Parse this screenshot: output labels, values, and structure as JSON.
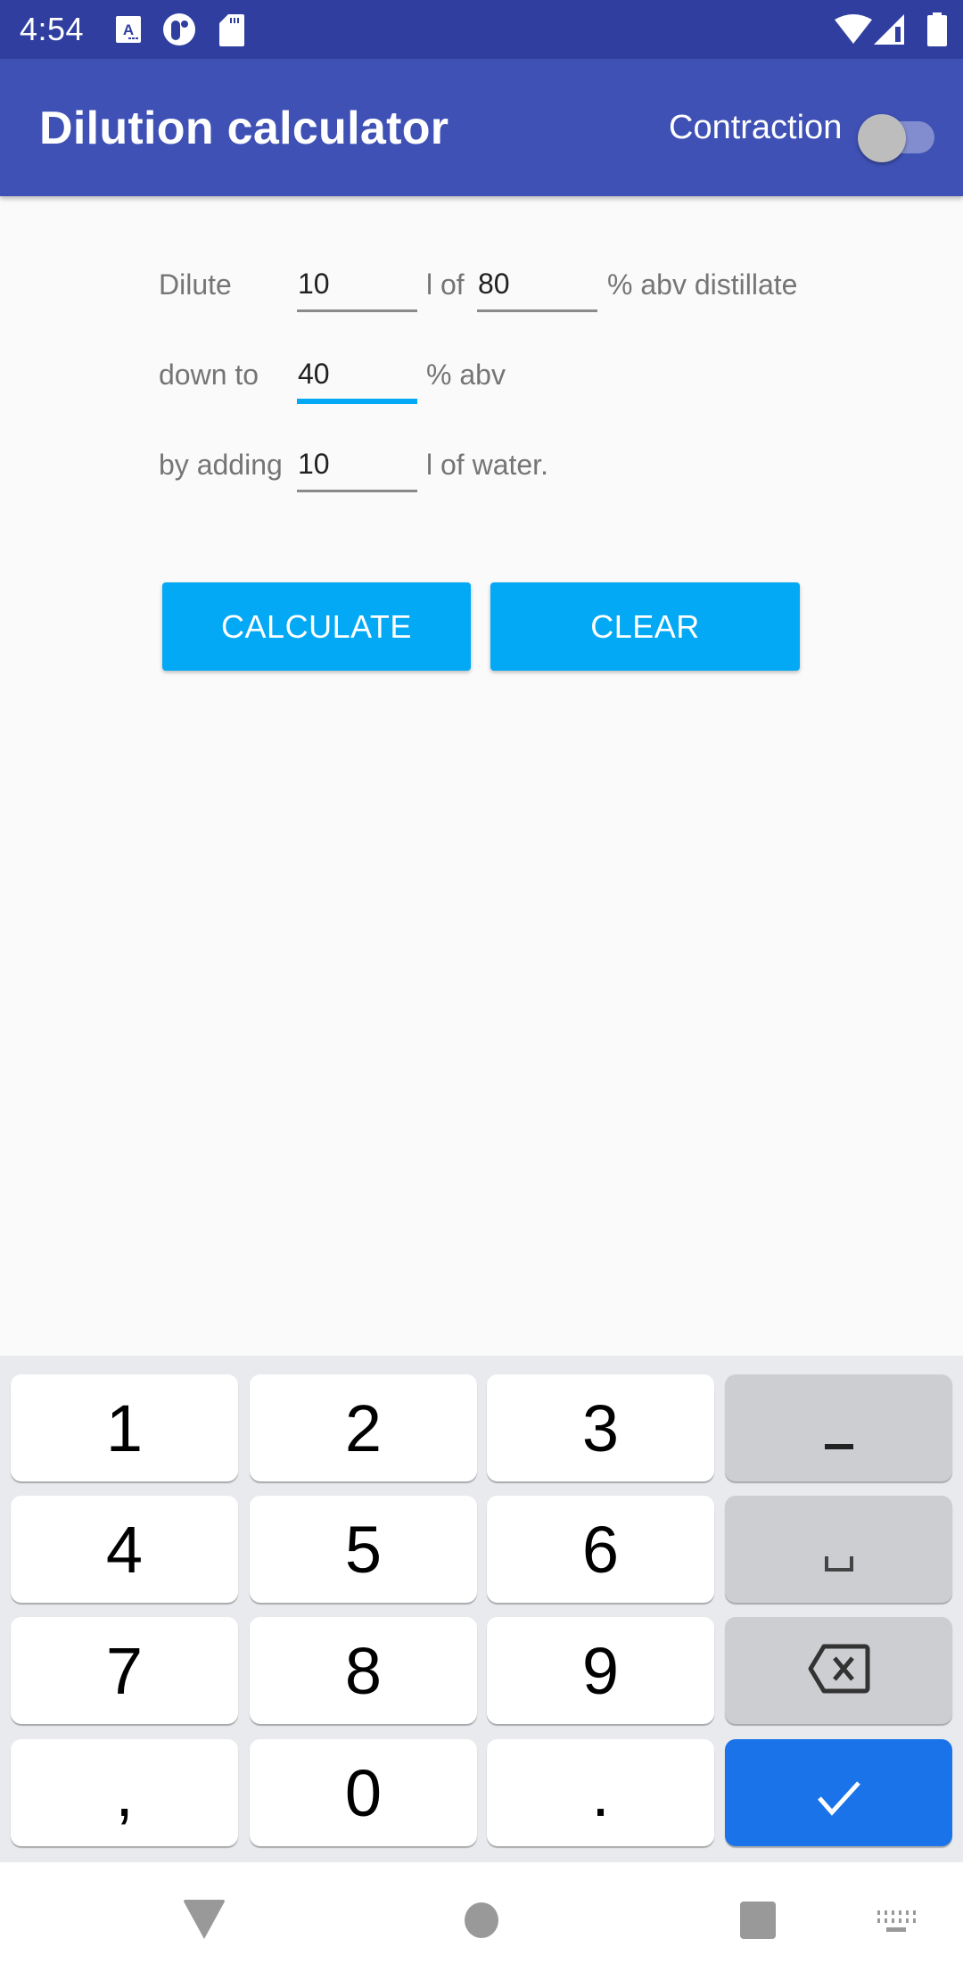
{
  "status_bar": {
    "time": "4:54",
    "left_icons": [
      "accessibility-text-icon",
      "assistant-icon",
      "sd-card-icon"
    ],
    "right_icons": [
      "wifi-icon",
      "cellular-signal-icon",
      "battery-icon"
    ]
  },
  "app_bar": {
    "title": "Dilution calculator",
    "toggle_label": "Contraction",
    "toggle_on": false
  },
  "form": {
    "row1": {
      "label": "Dilute",
      "volume_value": "10",
      "volume_unit": "l of",
      "abv_value": "80",
      "abv_suffix": "% abv distillate"
    },
    "row2": {
      "label": "down to",
      "target_abv_value": "40",
      "suffix": "% abv",
      "focused": true
    },
    "row3": {
      "label": "by adding",
      "water_value": "10",
      "suffix": "l of water."
    }
  },
  "buttons": {
    "calculate": "CALCULATE",
    "clear": "CLEAR"
  },
  "accent_colors": {
    "status_bar": "#303F9F",
    "app_bar": "#3F51B5",
    "button": "#03A9F4",
    "keyboard_enter": "#1A73E8"
  },
  "keyboard": {
    "keys": [
      [
        "1",
        "2",
        "3",
        "-"
      ],
      [
        "4",
        "5",
        "6",
        "space"
      ],
      [
        "7",
        "8",
        "9",
        "backspace"
      ],
      [
        ",",
        "0",
        ".",
        "done"
      ]
    ]
  },
  "nav_bar": {
    "buttons": [
      "back",
      "home",
      "recents",
      "keyboard-switch"
    ]
  }
}
